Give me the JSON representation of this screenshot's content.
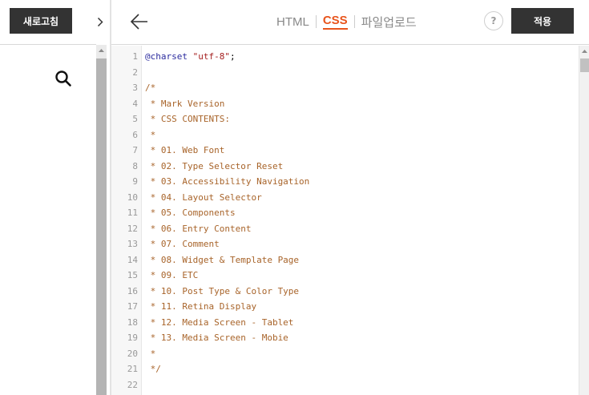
{
  "left": {
    "refresh_label": "새로고침"
  },
  "header": {
    "tabs": [
      {
        "label": "HTML",
        "active": false
      },
      {
        "label": "CSS",
        "active": true
      },
      {
        "label": "파일업로드",
        "active": false
      }
    ],
    "help_label": "?",
    "apply_label": "적용"
  },
  "icons": {
    "search": "search-icon",
    "back": "arrow-left-icon",
    "toggle": "chevron-right-icon",
    "scroll_up": "triangle-up-icon"
  },
  "colors": {
    "accent": "#e8541c",
    "button_bg": "#333333",
    "comment": "#a8642a",
    "keyword": "#2b2b9e",
    "string": "#a51f1f"
  },
  "editor": {
    "lines": [
      {
        "num": "1",
        "parts": [
          {
            "t": "kw",
            "s": "@charset"
          },
          {
            "t": "plain",
            "s": " "
          },
          {
            "t": "str",
            "s": "\"utf-8\""
          },
          {
            "t": "plain",
            "s": ";"
          }
        ]
      },
      {
        "num": "2",
        "parts": []
      },
      {
        "num": "3",
        "parts": [
          {
            "t": "cm",
            "s": "/*"
          }
        ]
      },
      {
        "num": "4",
        "parts": [
          {
            "t": "cm",
            "s": " * Mark Version"
          }
        ]
      },
      {
        "num": "5",
        "parts": [
          {
            "t": "cm",
            "s": " * CSS CONTENTS:"
          }
        ]
      },
      {
        "num": "6",
        "parts": [
          {
            "t": "cm",
            "s": " *"
          }
        ]
      },
      {
        "num": "7",
        "parts": [
          {
            "t": "cm",
            "s": " * 01. Web Font"
          }
        ]
      },
      {
        "num": "8",
        "parts": [
          {
            "t": "cm",
            "s": " * 02. Type Selector Reset"
          }
        ]
      },
      {
        "num": "9",
        "parts": [
          {
            "t": "cm",
            "s": " * 03. Accessibility Navigation"
          }
        ]
      },
      {
        "num": "10",
        "parts": [
          {
            "t": "cm",
            "s": " * 04. Layout Selector"
          }
        ]
      },
      {
        "num": "11",
        "parts": [
          {
            "t": "cm",
            "s": " * 05. Components"
          }
        ]
      },
      {
        "num": "12",
        "parts": [
          {
            "t": "cm",
            "s": " * 06. Entry Content"
          }
        ]
      },
      {
        "num": "13",
        "parts": [
          {
            "t": "cm",
            "s": " * 07. Comment"
          }
        ]
      },
      {
        "num": "14",
        "parts": [
          {
            "t": "cm",
            "s": " * 08. Widget & Template Page"
          }
        ]
      },
      {
        "num": "15",
        "parts": [
          {
            "t": "cm",
            "s": " * 09. ETC"
          }
        ]
      },
      {
        "num": "16",
        "parts": [
          {
            "t": "cm",
            "s": " * 10. Post Type & Color Type"
          }
        ]
      },
      {
        "num": "17",
        "parts": [
          {
            "t": "cm",
            "s": " * 11. Retina Display"
          }
        ]
      },
      {
        "num": "18",
        "parts": [
          {
            "t": "cm",
            "s": " * 12. Media Screen - Tablet"
          }
        ]
      },
      {
        "num": "19",
        "parts": [
          {
            "t": "cm",
            "s": " * 13. Media Screen - Mobie"
          }
        ]
      },
      {
        "num": "20",
        "parts": [
          {
            "t": "cm",
            "s": " *"
          }
        ]
      },
      {
        "num": "21",
        "parts": [
          {
            "t": "cm",
            "s": " */"
          }
        ]
      },
      {
        "num": "22",
        "parts": []
      }
    ]
  }
}
